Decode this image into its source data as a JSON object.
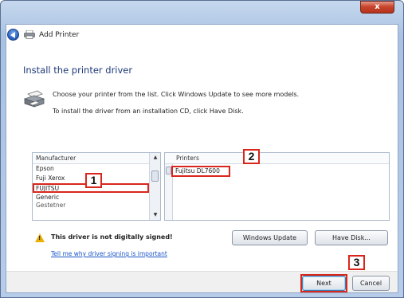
{
  "window": {
    "title": "Add Printer",
    "close_glyph": "x"
  },
  "page": {
    "heading": "Install the printer driver",
    "description_1": "Choose your printer from the list. Click Windows Update to see more models.",
    "description_2": "To install the driver from an installation CD, click Have Disk."
  },
  "manufacturer_list": {
    "header": "Manufacturer",
    "items": [
      "Epson",
      "Fuji Xerox",
      "FUJITSU",
      "Generic",
      "Gestetner"
    ],
    "selected": "FUJITSU"
  },
  "printer_list": {
    "header": "Printers",
    "items": [
      "Fujitsu DL7600"
    ]
  },
  "callouts": [
    "1",
    "2",
    "3"
  ],
  "warning": {
    "text": "This driver is not digitally signed!",
    "link": "Tell me why driver signing is important"
  },
  "buttons": {
    "windows_update": "Windows Update",
    "have_disk": "Have Disk...",
    "next": "Next",
    "cancel": "Cancel"
  },
  "colors": {
    "highlight": "#d9261c",
    "heading": "#1f3b7a",
    "link": "#1a55c7"
  },
  "icons": [
    "back-arrow-icon",
    "printer-icon",
    "warning-icon"
  ]
}
